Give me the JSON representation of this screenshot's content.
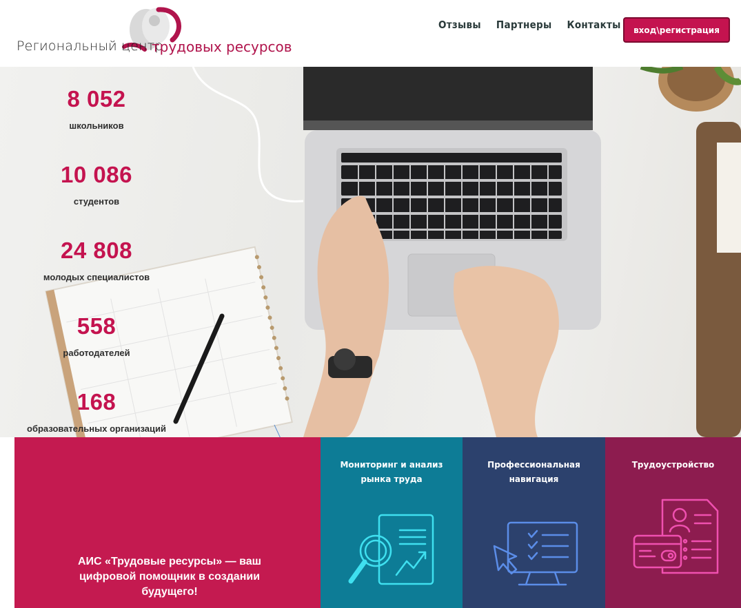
{
  "header": {
    "logo_text_left": "Региональный центр",
    "logo_text_right": "трудовых ресурсов",
    "nav": [
      "Отзывы",
      "Партнеры",
      "Контакты"
    ],
    "login_label": "вход\\регистрация"
  },
  "stats": [
    {
      "value": "8 052",
      "label": "школьников"
    },
    {
      "value": "10 086",
      "label": "студентов"
    },
    {
      "value": "24 808",
      "label": "молодых специалистов"
    },
    {
      "value": "558",
      "label": "работодателей"
    },
    {
      "value": "168",
      "label": "образовательных организаций"
    }
  ],
  "tagline": "АИС «Трудовые ресурсы» — ваш цифровой помощник в создании будущего!",
  "cards": [
    {
      "title": "Мониторинг и анализ рынка труда",
      "icon": "magnifier-chart-icon",
      "color": "#0d7c96"
    },
    {
      "title": "Профессиональная навигация",
      "icon": "monitor-checklist-icon",
      "color": "#2c416d"
    },
    {
      "title": "Трудоустройство",
      "icon": "resume-card-icon",
      "color": "#8d1c4f"
    }
  ],
  "colors": {
    "accent": "#c4134f",
    "tagline_bg": "#c41a50"
  }
}
